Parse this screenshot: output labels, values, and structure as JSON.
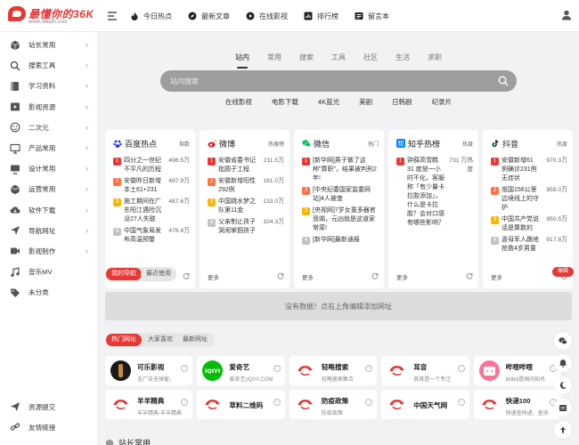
{
  "header": {
    "brand": "最懂你的36K",
    "url": "www.36kdh.com",
    "nav": [
      {
        "label": "今日热点",
        "icon": "flame-icon"
      },
      {
        "label": "最新文章",
        "icon": "compass-icon"
      },
      {
        "label": "在线影视",
        "icon": "play-icon"
      },
      {
        "label": "排行榜",
        "icon": "bar-chart-icon"
      },
      {
        "label": "留言本",
        "icon": "guestbook-icon"
      }
    ]
  },
  "sidebar": {
    "items": [
      {
        "label": "站长常用",
        "icon": "cube-icon"
      },
      {
        "label": "搜索工具",
        "icon": "search-icon"
      },
      {
        "label": "学习资料",
        "icon": "book-icon"
      },
      {
        "label": "影视资源",
        "icon": "film-icon"
      },
      {
        "label": "二次元",
        "icon": "anime-icon"
      },
      {
        "label": "产品常用",
        "icon": "monitor-icon"
      },
      {
        "label": "设计常用",
        "icon": "design-icon"
      },
      {
        "label": "运营常用",
        "icon": "box-icon"
      },
      {
        "label": "软件下载",
        "icon": "cloud-download-icon"
      },
      {
        "label": "导航网址",
        "icon": "navigation-icon"
      },
      {
        "label": "影视制作",
        "icon": "video-edit-icon"
      },
      {
        "label": "音乐MV",
        "icon": "music-icon"
      },
      {
        "label": "未分类",
        "icon": "tag-icon"
      }
    ],
    "footer": [
      {
        "label": "资源提交",
        "icon": "send-icon"
      },
      {
        "label": "友情链接",
        "icon": "link-icon"
      }
    ]
  },
  "search": {
    "tabs": [
      "站内",
      "常用",
      "搜索",
      "工具",
      "社区",
      "生活",
      "求职"
    ],
    "placeholder": "站内搜索",
    "quick_links": [
      "在线影视",
      "电影下载",
      "4K蓝光",
      "美剧",
      "日韩剧",
      "纪录片"
    ]
  },
  "hot": [
    {
      "name": "百度热点",
      "tag": "指数",
      "icon": "baidu-icon",
      "items": [
        {
          "t": "四分之一世纪 不平凡的历程",
          "v": "496.5万"
        },
        {
          "t": "安徽昨日新增本土61+231",
          "v": "497.9万"
        },
        {
          "t": "施工期间在广东阳江遇险沉没27人失联",
          "v": "487.6万"
        },
        {
          "t": "中国气象局发布高温预警",
          "v": "478.4万"
        }
      ]
    },
    {
      "name": "微博",
      "tag": "热搜榜",
      "icon": "weibo-icon",
      "items": [
        {
          "t": "安徽省委书记批圆子工程",
          "v": "211.5万"
        },
        {
          "t": "安徽新增阳性292例",
          "v": "181.0万"
        },
        {
          "t": "中国跳水梦之队第11金",
          "v": "133.0万"
        },
        {
          "t": "父亲制止孩子哭闹掌掴孩子",
          "v": "104.3万"
        }
      ]
    },
    {
      "name": "微信",
      "tag": "热门",
      "icon": "wechat-icon",
      "items": [
        {
          "t": "[新华网]男子做了这种\"算职\"，结果被判刑2年!",
          "v": ""
        },
        {
          "t": "[中央纪委国家监委网站]4人被查",
          "v": ""
        },
        {
          "t": "[央视网]7岁女童多器官衰竭，元凶就是这道家常菜!",
          "v": ""
        },
        {
          "t": "[新华网]最新通报",
          "v": ""
        }
      ]
    },
    {
      "name": "知乎热榜",
      "tag": "热度",
      "icon": "zhihu-icon",
      "items": [
        {
          "t": "钟薛高雪糕 31 度放一小时不化，客服称「有少量卡拉胶添加」，什么是卡拉胶？会对口感有哪些影响？",
          "v": "731 万热度"
        }
      ]
    },
    {
      "name": "抖音",
      "tag": "热度",
      "icon": "douyin-icon",
      "items": [
        {
          "t": "安徽新增61例确诊231例无症状",
          "v": "970.3万"
        },
        {
          "t": "祖国156公里边境线上的守护",
          "v": "959.0万"
        },
        {
          "t": "中国共产党说话是算数的",
          "v": "950.5万"
        },
        {
          "t": "逝母军人跪地抢救4岁男童",
          "v": "917.8万"
        }
      ]
    }
  ],
  "hot_footer": "更多",
  "my_nav": {
    "tab_active": "我的导航",
    "tab_other": "最近使用",
    "edit": "编辑",
    "empty": "没有数据！点右上角编辑添加网址"
  },
  "hot_sites": {
    "tabs": [
      "热门网址",
      "大家喜欢",
      "最新网址"
    ],
    "rows": [
      [
        {
          "name": "可乐影视",
          "desc": "无广告无弹窗，",
          "logo": "cola-logo"
        },
        {
          "name": "爱奇艺",
          "desc": "爱奇艺(iQIYI.COM",
          "logo": "iqiyi-logo"
        },
        {
          "name": "轻略搜索",
          "desc": "轻略搜索聚合",
          "logo": "bird-logo"
        },
        {
          "name": "耳音",
          "desc": "首首是一个专注",
          "logo": "bird-logo"
        },
        {
          "name": "哔哩哔哩",
          "desc": "bilibili是国内知名",
          "logo": "bilibili-logo"
        }
      ],
      [
        {
          "name": "羊羊精典",
          "desc": "羊羊精典-羊羊精典",
          "logo": "bird-logo"
        },
        {
          "name": "草料二维码",
          "desc": "",
          "logo": "bird-logo"
        },
        {
          "name": "防疫政策",
          "desc": "防疫政策",
          "logo": "bird-logo"
        },
        {
          "name": "中国天气网",
          "desc": "",
          "logo": "bird-logo"
        },
        {
          "name": "快递100",
          "desc": "快递查快递，查询",
          "logo": "bird-logo"
        }
      ]
    ]
  },
  "section_next": "站长常用",
  "colors": {
    "accent": "#e53935"
  }
}
